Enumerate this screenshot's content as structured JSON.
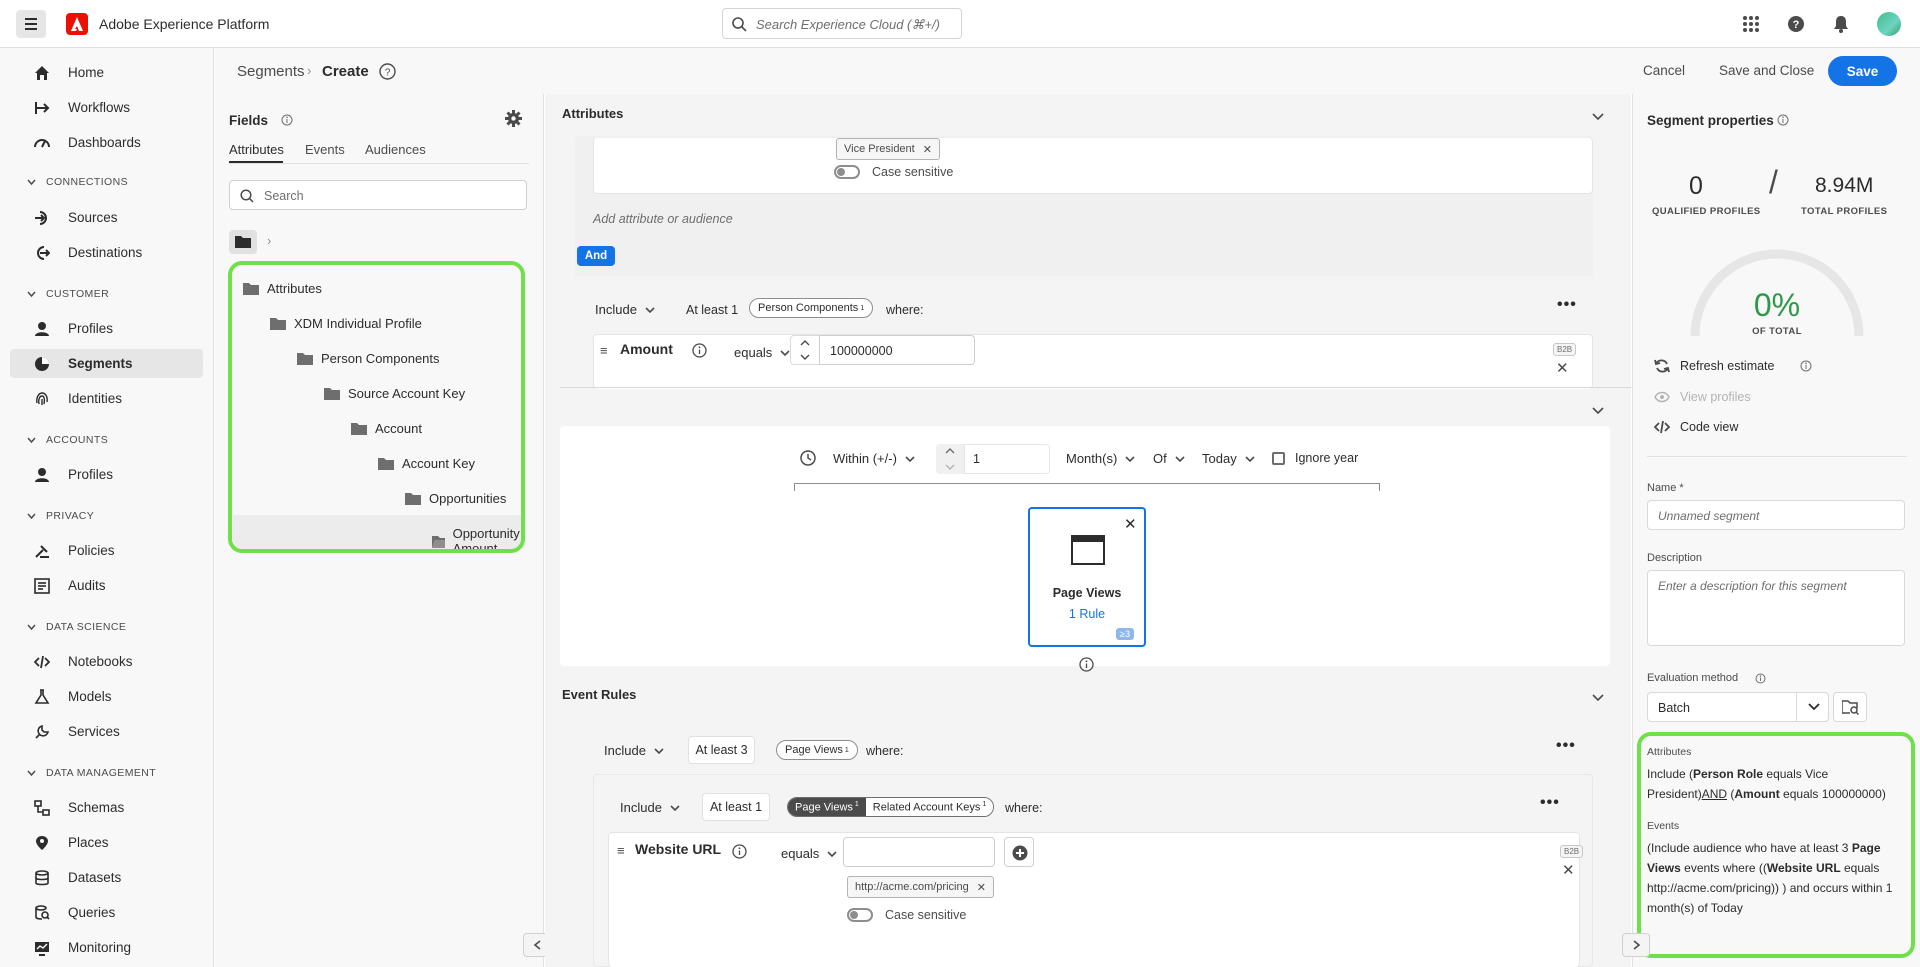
{
  "app": {
    "name": "Adobe Experience Platform",
    "search_placeholder": "Search Experience Cloud (⌘+/)"
  },
  "nav": {
    "items_top": [
      "Home",
      "Workflows",
      "Dashboards"
    ],
    "sections": [
      {
        "title": "CONNECTIONS",
        "items": [
          "Sources",
          "Destinations"
        ]
      },
      {
        "title": "CUSTOMER",
        "items": [
          "Profiles",
          "Segments",
          "Identities"
        ]
      },
      {
        "title": "ACCOUNTS",
        "items": [
          "Profiles"
        ]
      },
      {
        "title": "PRIVACY",
        "items": [
          "Policies",
          "Audits"
        ]
      },
      {
        "title": "DATA SCIENCE",
        "items": [
          "Notebooks",
          "Models",
          "Services"
        ]
      },
      {
        "title": "DATA MANAGEMENT",
        "items": [
          "Schemas",
          "Places",
          "Datasets",
          "Queries",
          "Monitoring"
        ]
      }
    ],
    "selected": "Segments"
  },
  "breadcrumb": {
    "parent": "Segments",
    "current": "Create"
  },
  "actions": {
    "cancel": "Cancel",
    "save_close": "Save and Close",
    "save": "Save"
  },
  "fields": {
    "title": "Fields",
    "tabs": [
      "Attributes",
      "Events",
      "Audiences"
    ],
    "search_placeholder": "Search",
    "tree": [
      "Attributes",
      "XDM Individual Profile",
      "Person Components",
      "Source Account Key",
      "Account",
      "Account Key",
      "Opportunities",
      "Opportunity Amount"
    ]
  },
  "attributes_section": {
    "title": "Attributes",
    "tag_vp": "Vice President",
    "case_sensitive": "Case sensitive",
    "add_placeholder": "Add attribute or audience",
    "and_label": "And",
    "include": "Include",
    "at_least": "At least 1",
    "person_components": "Person Components",
    "sup1": "1",
    "where": "where:",
    "amount_label": "Amount",
    "equals": "equals",
    "amount_value": "100000000",
    "b2b": "B2B"
  },
  "time_section": {
    "within": "Within (+/-)",
    "value": "1",
    "unit": "Month(s)",
    "of": "Of",
    "today": "Today",
    "ignore_year": "Ignore year",
    "card_title": "Page Views",
    "card_rule": "1 Rule",
    "card_badge": "≥3"
  },
  "event_rules": {
    "title": "Event Rules",
    "include": "Include",
    "at_least3": "At least 3",
    "page_views": "Page Views",
    "sup1": "1",
    "where": "where:",
    "include2": "Include",
    "at_least1": "At least 1",
    "related": "Related Account Keys",
    "website_url": "Website URL",
    "equals": "equals",
    "url_tag": "http://acme.com/pricing",
    "case_sensitive": "Case sensitive",
    "b2b": "B2B"
  },
  "segment_props": {
    "title": "Segment properties",
    "qualified": "0",
    "qualified_label": "QUALIFIED PROFILES",
    "total": "8.94M",
    "total_label": "TOTAL PROFILES",
    "percent": "0%",
    "of_total": "OF TOTAL",
    "refresh": "Refresh estimate",
    "view_profiles": "View profiles",
    "code_view": "Code view",
    "name_label": "Name *",
    "name_placeholder": "Unnamed segment",
    "desc_label": "Description",
    "desc_placeholder": "Enter a description for this segment",
    "eval_label": "Evaluation method",
    "eval_value": "Batch",
    "summary_attr_title": "Attributes",
    "summary_events_title": "Events"
  },
  "summary": {
    "a1": "Include (",
    "a2": "Person Role",
    "a3": " equals Vice President)",
    "a4": "AND",
    "a5": " (",
    "a6": "Amount",
    "a7": " equals 100000000)",
    "e1": "(Include audience who have at least 3 ",
    "e2": "Page Views",
    "e3": " events where ((",
    "e4": "Website URL",
    "e5": " equals http://acme.com/pricing)) ) and occurs within 1 month(s) of Today"
  },
  "colors": {
    "accent": "#1473e6",
    "highlight": "#6fe04a",
    "brand_red": "#eb1000"
  }
}
